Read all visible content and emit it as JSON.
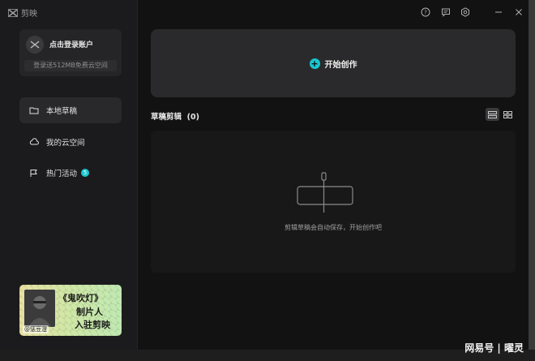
{
  "app": {
    "name": "剪映"
  },
  "titlebar": {
    "icons": [
      "help-icon",
      "feedback-icon",
      "settings-icon",
      "minimize-icon",
      "close-icon"
    ]
  },
  "sidebar": {
    "login": {
      "title": "点击登录账户",
      "subtitle": "登录送512MB免费云空间"
    },
    "items": [
      {
        "label": "本地草稿",
        "icon": "folder-icon",
        "active": true
      },
      {
        "label": "我的云空间",
        "icon": "cloud-icon",
        "active": false
      },
      {
        "label": "热门活动",
        "icon": "flag-icon",
        "active": false,
        "badge": "5"
      }
    ],
    "promo": {
      "line1": "《鬼吹灯》",
      "line2": "制片人",
      "line3": "入驻剪映",
      "tag": "@惩豆澄"
    }
  },
  "main": {
    "start_label": "开始创作",
    "drafts_title": "草稿剪辑",
    "drafts_count": "(0)",
    "empty_text": "剪辑草稿会自动保存，开始创作吧"
  },
  "watermark": "网易号 | 曜灵",
  "colors": {
    "accent": "#19c6cf",
    "background": "#121212",
    "sidebar": "#1b1b1d"
  }
}
